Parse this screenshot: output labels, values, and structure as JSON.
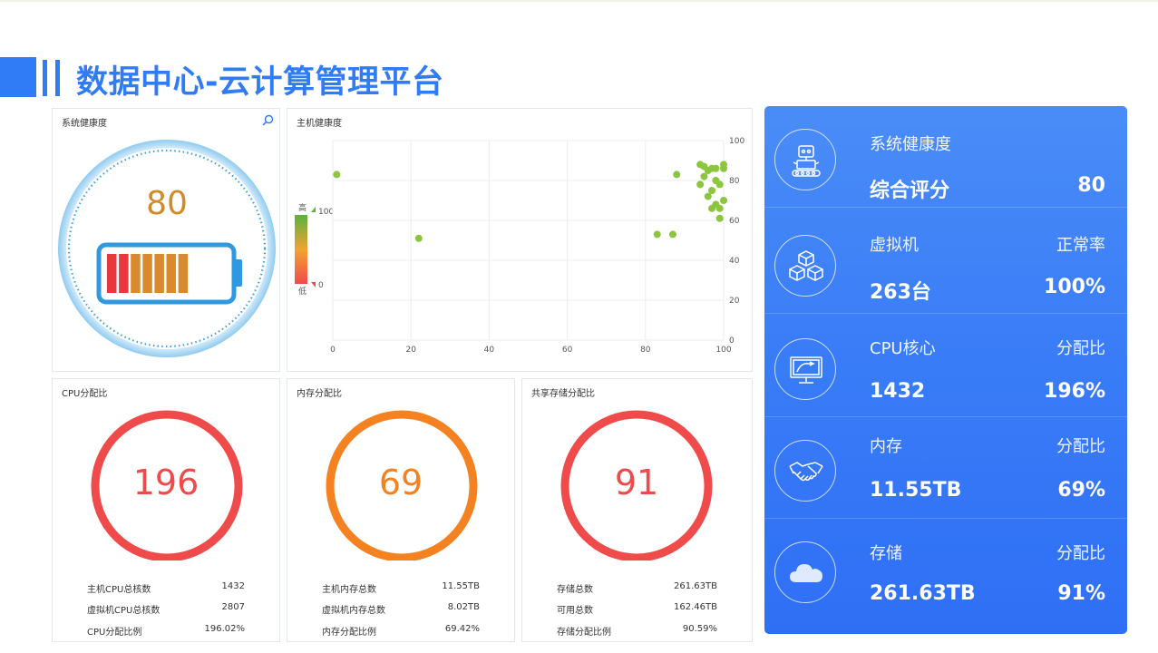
{
  "page": {
    "title": "数据中心-云计算管理平台"
  },
  "health_panel": {
    "title": "系统健康度",
    "score": "80",
    "battery_level": 0.8
  },
  "host_panel": {
    "title": "主机健康度",
    "legend": {
      "high": "高",
      "low": "低",
      "max": "100",
      "min": "0"
    }
  },
  "chart_data": {
    "type": "scatter",
    "title": "主机健康度",
    "xlim": [
      0,
      100
    ],
    "ylim": [
      0,
      100
    ],
    "x_ticks": [
      "0",
      "20",
      "40",
      "60",
      "80",
      "100"
    ],
    "y_ticks": [
      "0",
      "20",
      "40",
      "60",
      "80",
      "100"
    ],
    "y_axis_side": "right",
    "grid": true,
    "color": "#8cc63f",
    "points": [
      [
        1,
        83
      ],
      [
        22,
        51
      ],
      [
        83,
        53
      ],
      [
        87,
        53
      ],
      [
        88,
        83
      ],
      [
        94,
        88
      ],
      [
        95,
        87
      ],
      [
        96,
        85
      ],
      [
        95,
        82
      ],
      [
        97,
        86
      ],
      [
        98,
        86
      ],
      [
        100,
        88
      ],
      [
        100,
        86
      ],
      [
        94,
        78
      ],
      [
        98,
        80
      ],
      [
        99,
        78
      ],
      [
        97,
        75
      ],
      [
        96,
        72
      ],
      [
        100,
        70
      ],
      [
        98,
        68
      ],
      [
        99,
        66
      ],
      [
        97,
        66
      ],
      [
        99,
        61
      ]
    ]
  },
  "cpu_panel": {
    "title": "CPU分配比",
    "value": "196",
    "color": "#f04b4b",
    "rows": [
      {
        "k": "主机CPU总核数",
        "v": "1432"
      },
      {
        "k": "虚拟机CPU总核数",
        "v": "2807"
      },
      {
        "k": "CPU分配比例",
        "v": "196.02%"
      }
    ]
  },
  "mem_panel": {
    "title": "内存分配比",
    "value": "69",
    "color": "#f58220",
    "rows": [
      {
        "k": "主机内存总数",
        "v": "11.55TB"
      },
      {
        "k": "虚拟机内存总数",
        "v": "8.02TB"
      },
      {
        "k": "内存分配比例",
        "v": "69.42%"
      }
    ]
  },
  "storage_panel": {
    "title": "共享存储分配比",
    "value": "91",
    "color": "#f04b4b",
    "rows": [
      {
        "k": "存储总数",
        "v": "261.63TB"
      },
      {
        "k": "可用总数",
        "v": "162.46TB"
      },
      {
        "k": "存储分配比例",
        "v": "90.59%"
      }
    ]
  },
  "summary": {
    "rows": [
      {
        "icon": "robot-icon",
        "label": "系统健康度",
        "right_label": "",
        "value": "综合评分",
        "right_value": "80"
      },
      {
        "icon": "cubes-icon",
        "label": "虚拟机",
        "right_label": "正常率",
        "value": "263台",
        "right_value": "100%"
      },
      {
        "icon": "monitor-icon",
        "label": "CPU核心",
        "right_label": "分配比",
        "value": "1432",
        "right_value": "196%"
      },
      {
        "icon": "handshake-icon",
        "label": "内存",
        "right_label": "分配比",
        "value": "11.55TB",
        "right_value": "69%"
      },
      {
        "icon": "cloud-icon",
        "label": "存储",
        "right_label": "分配比",
        "value": "261.63TB",
        "right_value": "91%"
      }
    ]
  }
}
